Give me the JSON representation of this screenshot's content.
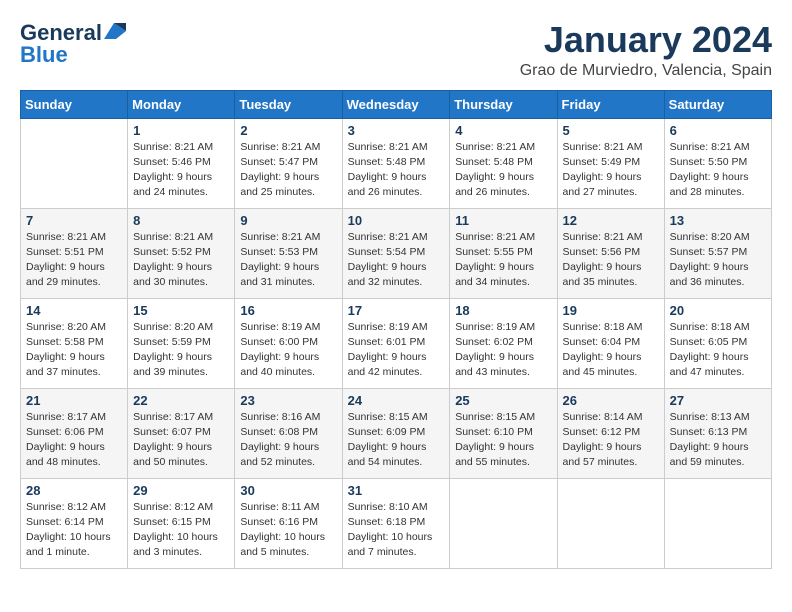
{
  "header": {
    "logo_line1": "General",
    "logo_line2": "Blue",
    "month_title": "January 2024",
    "location": "Grao de Murviedro, Valencia, Spain"
  },
  "weekdays": [
    "Sunday",
    "Monday",
    "Tuesday",
    "Wednesday",
    "Thursday",
    "Friday",
    "Saturday"
  ],
  "weeks": [
    [
      {
        "day": "",
        "info": ""
      },
      {
        "day": "1",
        "info": "Sunrise: 8:21 AM\nSunset: 5:46 PM\nDaylight: 9 hours\nand 24 minutes."
      },
      {
        "day": "2",
        "info": "Sunrise: 8:21 AM\nSunset: 5:47 PM\nDaylight: 9 hours\nand 25 minutes."
      },
      {
        "day": "3",
        "info": "Sunrise: 8:21 AM\nSunset: 5:48 PM\nDaylight: 9 hours\nand 26 minutes."
      },
      {
        "day": "4",
        "info": "Sunrise: 8:21 AM\nSunset: 5:48 PM\nDaylight: 9 hours\nand 26 minutes."
      },
      {
        "day": "5",
        "info": "Sunrise: 8:21 AM\nSunset: 5:49 PM\nDaylight: 9 hours\nand 27 minutes."
      },
      {
        "day": "6",
        "info": "Sunrise: 8:21 AM\nSunset: 5:50 PM\nDaylight: 9 hours\nand 28 minutes."
      }
    ],
    [
      {
        "day": "7",
        "info": "Sunrise: 8:21 AM\nSunset: 5:51 PM\nDaylight: 9 hours\nand 29 minutes."
      },
      {
        "day": "8",
        "info": "Sunrise: 8:21 AM\nSunset: 5:52 PM\nDaylight: 9 hours\nand 30 minutes."
      },
      {
        "day": "9",
        "info": "Sunrise: 8:21 AM\nSunset: 5:53 PM\nDaylight: 9 hours\nand 31 minutes."
      },
      {
        "day": "10",
        "info": "Sunrise: 8:21 AM\nSunset: 5:54 PM\nDaylight: 9 hours\nand 32 minutes."
      },
      {
        "day": "11",
        "info": "Sunrise: 8:21 AM\nSunset: 5:55 PM\nDaylight: 9 hours\nand 34 minutes."
      },
      {
        "day": "12",
        "info": "Sunrise: 8:21 AM\nSunset: 5:56 PM\nDaylight: 9 hours\nand 35 minutes."
      },
      {
        "day": "13",
        "info": "Sunrise: 8:20 AM\nSunset: 5:57 PM\nDaylight: 9 hours\nand 36 minutes."
      }
    ],
    [
      {
        "day": "14",
        "info": "Sunrise: 8:20 AM\nSunset: 5:58 PM\nDaylight: 9 hours\nand 37 minutes."
      },
      {
        "day": "15",
        "info": "Sunrise: 8:20 AM\nSunset: 5:59 PM\nDaylight: 9 hours\nand 39 minutes."
      },
      {
        "day": "16",
        "info": "Sunrise: 8:19 AM\nSunset: 6:00 PM\nDaylight: 9 hours\nand 40 minutes."
      },
      {
        "day": "17",
        "info": "Sunrise: 8:19 AM\nSunset: 6:01 PM\nDaylight: 9 hours\nand 42 minutes."
      },
      {
        "day": "18",
        "info": "Sunrise: 8:19 AM\nSunset: 6:02 PM\nDaylight: 9 hours\nand 43 minutes."
      },
      {
        "day": "19",
        "info": "Sunrise: 8:18 AM\nSunset: 6:04 PM\nDaylight: 9 hours\nand 45 minutes."
      },
      {
        "day": "20",
        "info": "Sunrise: 8:18 AM\nSunset: 6:05 PM\nDaylight: 9 hours\nand 47 minutes."
      }
    ],
    [
      {
        "day": "21",
        "info": "Sunrise: 8:17 AM\nSunset: 6:06 PM\nDaylight: 9 hours\nand 48 minutes."
      },
      {
        "day": "22",
        "info": "Sunrise: 8:17 AM\nSunset: 6:07 PM\nDaylight: 9 hours\nand 50 minutes."
      },
      {
        "day": "23",
        "info": "Sunrise: 8:16 AM\nSunset: 6:08 PM\nDaylight: 9 hours\nand 52 minutes."
      },
      {
        "day": "24",
        "info": "Sunrise: 8:15 AM\nSunset: 6:09 PM\nDaylight: 9 hours\nand 54 minutes."
      },
      {
        "day": "25",
        "info": "Sunrise: 8:15 AM\nSunset: 6:10 PM\nDaylight: 9 hours\nand 55 minutes."
      },
      {
        "day": "26",
        "info": "Sunrise: 8:14 AM\nSunset: 6:12 PM\nDaylight: 9 hours\nand 57 minutes."
      },
      {
        "day": "27",
        "info": "Sunrise: 8:13 AM\nSunset: 6:13 PM\nDaylight: 9 hours\nand 59 minutes."
      }
    ],
    [
      {
        "day": "28",
        "info": "Sunrise: 8:12 AM\nSunset: 6:14 PM\nDaylight: 10 hours\nand 1 minute."
      },
      {
        "day": "29",
        "info": "Sunrise: 8:12 AM\nSunset: 6:15 PM\nDaylight: 10 hours\nand 3 minutes."
      },
      {
        "day": "30",
        "info": "Sunrise: 8:11 AM\nSunset: 6:16 PM\nDaylight: 10 hours\nand 5 minutes."
      },
      {
        "day": "31",
        "info": "Sunrise: 8:10 AM\nSunset: 6:18 PM\nDaylight: 10 hours\nand 7 minutes."
      },
      {
        "day": "",
        "info": ""
      },
      {
        "day": "",
        "info": ""
      },
      {
        "day": "",
        "info": ""
      }
    ]
  ]
}
